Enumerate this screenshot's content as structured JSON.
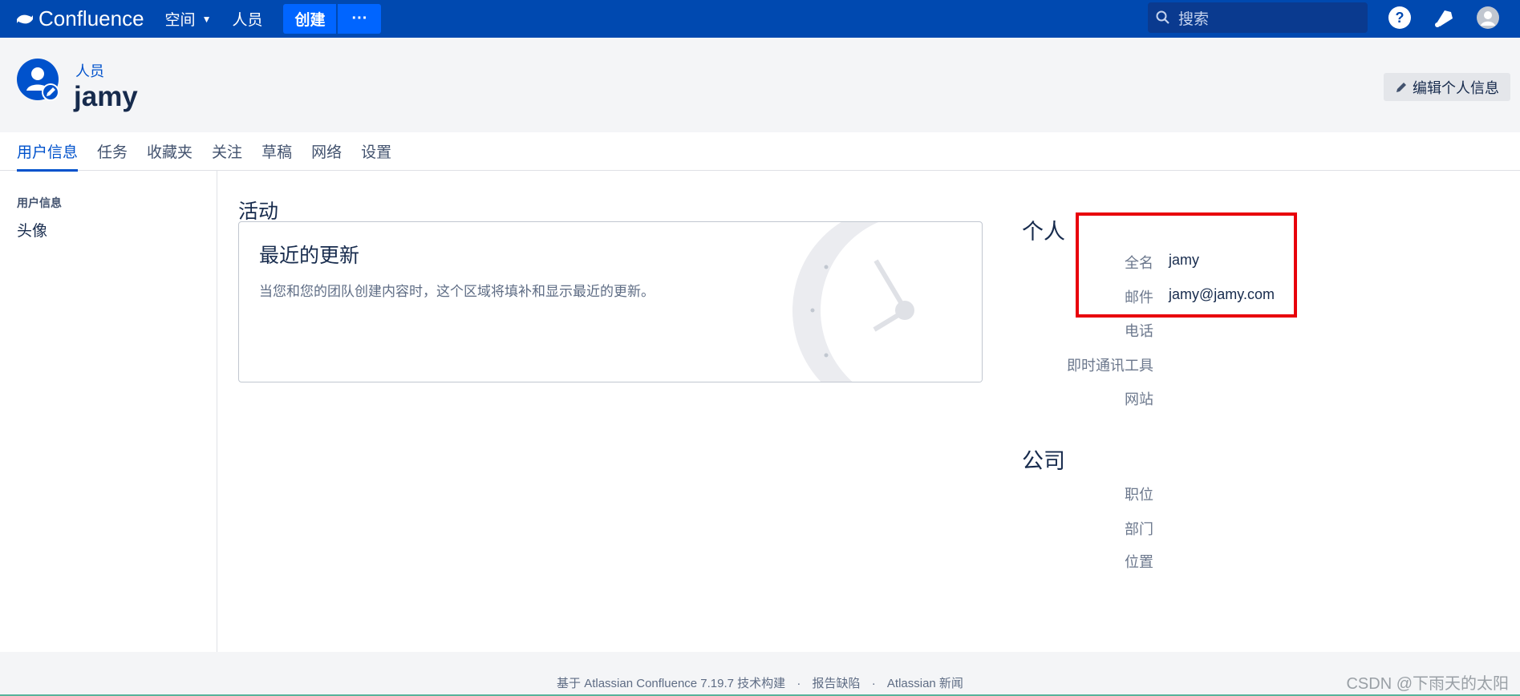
{
  "topnav": {
    "logo_text": "Confluence",
    "spaces_label": "空间",
    "people_label": "人员",
    "create_label": "创建",
    "more_label": "···",
    "search_placeholder": "搜索",
    "colors": {
      "bar": "#0049b0",
      "button": "#0065ff"
    }
  },
  "header": {
    "breadcrumb": "人员",
    "title": "jamy",
    "edit_label": "编辑个人信息"
  },
  "tabs": [
    {
      "label": "用户信息",
      "active": true
    },
    {
      "label": "任务"
    },
    {
      "label": "收藏夹"
    },
    {
      "label": "关注"
    },
    {
      "label": "草稿"
    },
    {
      "label": "网络"
    },
    {
      "label": "设置"
    }
  ],
  "sidebar": {
    "heading": "用户信息",
    "items": [
      {
        "label": "头像"
      }
    ]
  },
  "activity": {
    "title": "活动",
    "card_title": "最近的更新",
    "card_desc": "当您和您的团队创建内容时，这个区域将填补和显示最近的更新。"
  },
  "profile": {
    "personal_title": "个人",
    "personal_fields": [
      {
        "label": "全名",
        "value": "jamy"
      },
      {
        "label": "邮件",
        "value": "jamy@jamy.com"
      },
      {
        "label": "电话",
        "value": ""
      },
      {
        "label": "即时通讯工具",
        "value": ""
      },
      {
        "label": "网站",
        "value": ""
      }
    ],
    "company_title": "公司",
    "company_fields": [
      {
        "label": "职位",
        "value": ""
      },
      {
        "label": "部门",
        "value": ""
      },
      {
        "label": "位置",
        "value": ""
      }
    ],
    "highlight_color": "#e8000b"
  },
  "footer": {
    "powered_by": "基于 Atlassian Confluence 7.19.7 技术构建",
    "report_bug": "报告缺陷",
    "news": "Atlassian 新闻",
    "separator": "·",
    "watermark": "CSDN @下雨天的太阳"
  }
}
